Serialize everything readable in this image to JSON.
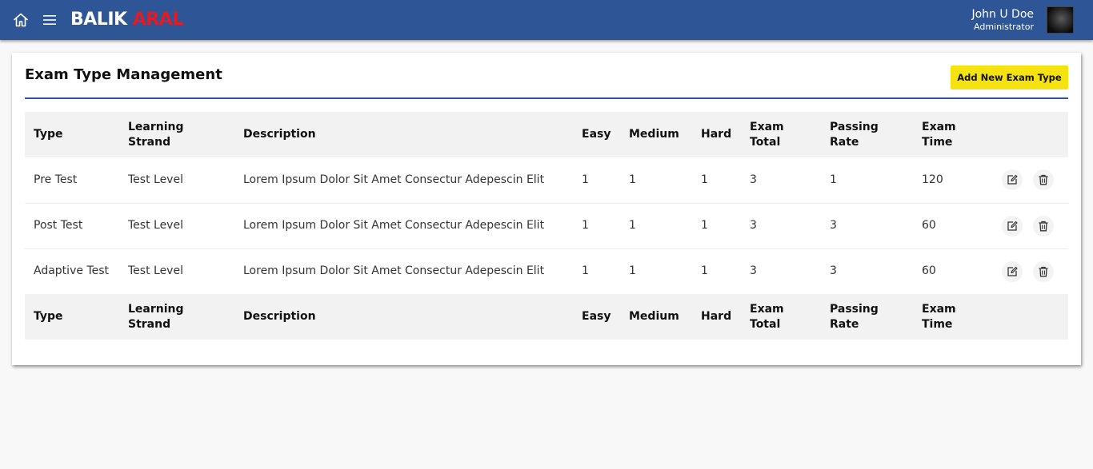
{
  "header": {
    "brand_part1": "BALIK",
    "brand_part2": "ARAL",
    "brand_colors": {
      "primary": "#ffffff",
      "accent": "#e31b23",
      "bar": "#2e5596"
    },
    "user_name": "John U Doe",
    "user_role": "Administrator",
    "icons": [
      "home-icon",
      "hamburger-menu-icon"
    ]
  },
  "main": {
    "title": "Exam Type Management",
    "add_button_label": "Add New Exam Type",
    "add_button_color": "#f5e311",
    "table": {
      "columns": [
        {
          "line1": "Type",
          "line2": ""
        },
        {
          "line1": "Learning",
          "line2": "Strand"
        },
        {
          "line1": "Description",
          "line2": ""
        },
        {
          "line1": "Easy",
          "line2": ""
        },
        {
          "line1": "Medium",
          "line2": ""
        },
        {
          "line1": "Hard",
          "line2": ""
        },
        {
          "line1": "Exam",
          "line2": "Total"
        },
        {
          "line1": "Passing",
          "line2": "Rate"
        },
        {
          "line1": "Exam",
          "line2": "Time"
        }
      ],
      "rows": [
        {
          "type": "Pre Test",
          "strand": "Test Level",
          "description": "Lorem Ipsum Dolor Sit Amet Consectur Adepescin Elit",
          "easy": "1",
          "medium": "1",
          "hard": "1",
          "total": "3",
          "passing": "1",
          "time": "120"
        },
        {
          "type": "Post Test",
          "strand": "Test Level",
          "description": "Lorem Ipsum Dolor Sit Amet Consectur Adepescin Elit",
          "easy": "1",
          "medium": "1",
          "hard": "1",
          "total": "3",
          "passing": "3",
          "time": "60"
        },
        {
          "type": "Adaptive Test",
          "strand": "Test Level",
          "description": "Lorem Ipsum Dolor Sit Amet Consectur Adepescin Elit",
          "easy": "1",
          "medium": "1",
          "hard": "1",
          "total": "3",
          "passing": "3",
          "time": "60"
        }
      ],
      "row_action_icons": [
        "edit-icon",
        "trash-icon"
      ]
    }
  }
}
